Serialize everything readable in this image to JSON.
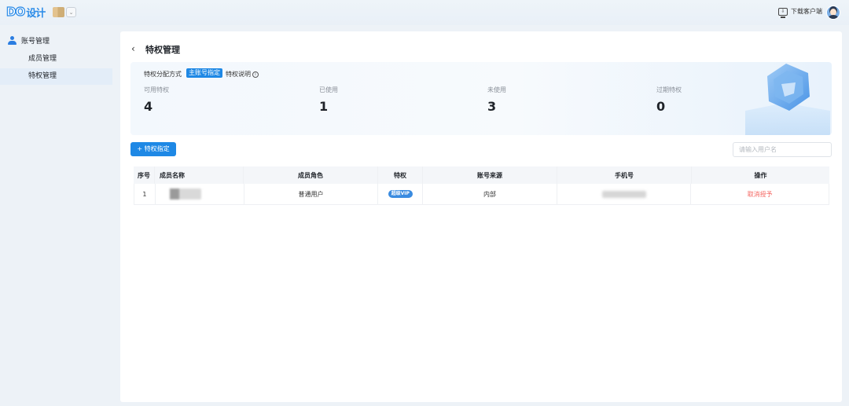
{
  "app": {
    "logo_do": "DO",
    "logo_cn": "设计"
  },
  "header": {
    "download_label": "下载客户端",
    "monitor_glyph": "⇩",
    "switch_glyph": "⌄"
  },
  "sidebar": {
    "group_label": "账号管理",
    "items": [
      {
        "label": "成员管理",
        "active": false
      },
      {
        "label": "特权管理",
        "active": true
      }
    ]
  },
  "page": {
    "back_glyph": "‹",
    "title": "特权管理"
  },
  "allocation": {
    "label": "特权分配方式",
    "mode_tag": "主账号指定",
    "info_label": "特权说明",
    "info_glyph": "i"
  },
  "stats": [
    {
      "label": "可用特权",
      "value": "4"
    },
    {
      "label": "已使用",
      "value": "1"
    },
    {
      "label": "未使用",
      "value": "3"
    },
    {
      "label": "过期特权",
      "value": "0"
    }
  ],
  "toolbar": {
    "assign_label": "+ 特权指定",
    "search_placeholder": "请输入用户名"
  },
  "table": {
    "headers": [
      "序号",
      "成员名称",
      "成员角色",
      "特权",
      "账号来源",
      "手机号",
      "操作"
    ],
    "rows": [
      {
        "index": "1",
        "role": "普通用户",
        "privilege": "超级VIP",
        "source": "内部",
        "action": "取消授予"
      }
    ]
  },
  "colors": {
    "accent": "#1e88e5",
    "danger": "#f4645f",
    "background": "#edf2f7"
  },
  "icons": [
    "person-icon",
    "back-icon",
    "info-icon",
    "monitor-download-icon",
    "chevron-down-icon",
    "gem-illustration"
  ]
}
